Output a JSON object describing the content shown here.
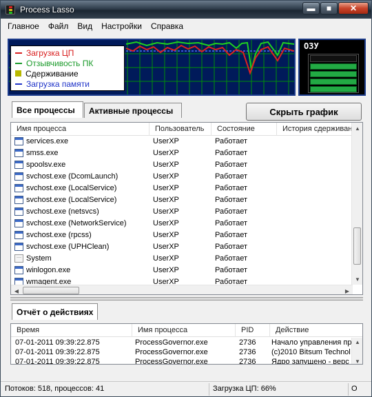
{
  "window": {
    "title": "Process Lasso",
    "minimize": "▬",
    "maximize": "■",
    "close": "✕"
  },
  "menu": [
    "Главное",
    "Файл",
    "Вид",
    "Настройки",
    "Справка"
  ],
  "graph": {
    "legend": [
      {
        "label": "Загрузка ЦП",
        "color": "#d81e1e",
        "style": "solid"
      },
      {
        "label": "Отзывчивость ПК",
        "color": "#1a9a2a",
        "style": "solid"
      },
      {
        "label": "Сдерживание",
        "color": "#b8b800",
        "style": "box"
      },
      {
        "label": "Загрузка памяти",
        "color": "#1e32c8",
        "style": "dashed"
      }
    ],
    "ram_label": "ОЗУ"
  },
  "tabs": {
    "all": "Все процессы",
    "active": "Активные процессы",
    "hide_graph": "Скрыть график"
  },
  "columns": [
    "Имя процесса",
    "Пользователь",
    "Состояние",
    "История сдерживания"
  ],
  "processes": [
    {
      "name": "services.exe",
      "user": "UserXP",
      "state": "Работает",
      "icon": "window-icon"
    },
    {
      "name": "smss.exe",
      "user": "UserXP",
      "state": "Работает",
      "icon": "window-icon"
    },
    {
      "name": "spoolsv.exe",
      "user": "UserXP",
      "state": "Работает",
      "icon": "window-icon"
    },
    {
      "name": "svchost.exe (DcomLaunch)",
      "user": "UserXP",
      "state": "Работает",
      "icon": "window-icon"
    },
    {
      "name": "svchost.exe (LocalService)",
      "user": "UserXP",
      "state": "Работает",
      "icon": "window-icon"
    },
    {
      "name": "svchost.exe (LocalService)",
      "user": "UserXP",
      "state": "Работает",
      "icon": "window-icon"
    },
    {
      "name": "svchost.exe (netsvcs)",
      "user": "UserXP",
      "state": "Работает",
      "icon": "window-icon"
    },
    {
      "name": "svchost.exe (NetworkService)",
      "user": "UserXP",
      "state": "Работает",
      "icon": "window-icon"
    },
    {
      "name": "svchost.exe (rpcss)",
      "user": "UserXP",
      "state": "Работает",
      "icon": "window-icon"
    },
    {
      "name": "svchost.exe (UPHClean)",
      "user": "UserXP",
      "state": "Работает",
      "icon": "window-icon"
    },
    {
      "name": "System",
      "user": "UserXP",
      "state": "Работает",
      "icon": "document-icon"
    },
    {
      "name": "winlogon.exe",
      "user": "UserXP",
      "state": "Работает",
      "icon": "window-icon"
    },
    {
      "name": "wmagent.exe",
      "user": "UserXP",
      "state": "Работает",
      "icon": "window-icon"
    }
  ],
  "log": {
    "tab": "Отчёт о действиях",
    "columns": [
      "Время",
      "Имя процесса",
      "PID",
      "Действие"
    ],
    "rows": [
      {
        "time": "07-01-2011 09:39:22.875",
        "process": "ProcessGovernor.exe",
        "pid": "2736",
        "action": "Начало управления пр"
      },
      {
        "time": "07-01-2011 09:39:22.875",
        "process": "ProcessGovernor.exe",
        "pid": "2736",
        "action": "(c)2010 Bitsum Technol"
      },
      {
        "time": "07-01-2011 09:39:22.875",
        "process": "ProcessGovernor.exe",
        "pid": "2736",
        "action": "Ядро запущено - верс"
      }
    ]
  },
  "status": {
    "counts": "Потоков: 518,  процессов: 41",
    "cpu": "Загрузка ЦП: 66%",
    "extra": "О"
  }
}
